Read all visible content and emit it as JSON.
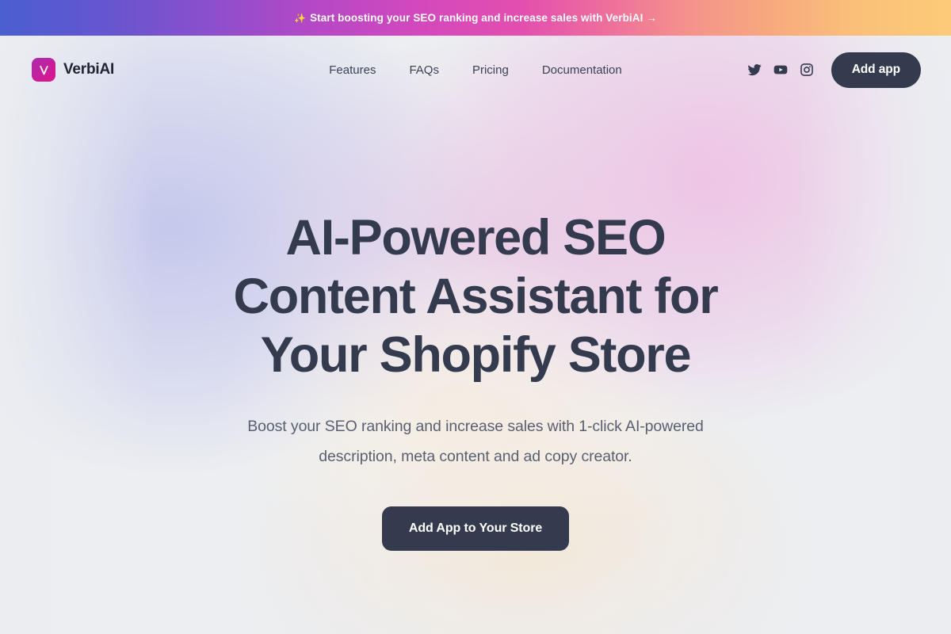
{
  "announcement": {
    "sparkle_icon": "sparkles-icon",
    "text": "Start boosting your SEO ranking and increase sales with VerbiAI →",
    "gradient_start": "#4a5fd0",
    "gradient_mid": "#d348bd",
    "gradient_end": "#fccb78"
  },
  "header": {
    "brand": {
      "name": "VerbiAI",
      "mark_icon": "verbiai-v-shield-icon",
      "mark_color_start": "#a82fae",
      "mark_color_end": "#e0148c"
    },
    "nav": [
      {
        "label": "Features"
      },
      {
        "label": "FAQs"
      },
      {
        "label": "Pricing"
      },
      {
        "label": "Documentation"
      }
    ],
    "social": [
      {
        "name": "twitter-icon",
        "label": "Twitter"
      },
      {
        "name": "youtube-icon",
        "label": "YouTube"
      },
      {
        "name": "instagram-icon",
        "label": "Instagram"
      }
    ],
    "add_app_label": "Add app",
    "button_color": "#343b4f"
  },
  "hero": {
    "title_line1": "AI-Powered SEO",
    "title_line2": "Content Assistant for",
    "title_line3": "Your Shopify Store",
    "subtitle_line1": "Boost your SEO ranking and increase sales with 1-click AI-powered",
    "subtitle_line2": "description, meta content and ad copy creator.",
    "cta_label": "Add App to Your Store",
    "title_color": "#343b4f",
    "subtitle_color": "#5a6071",
    "background_lavender": "#dcdcee",
    "background_pink": "#e6d2ec",
    "background_cream": "#f2ebe3",
    "background_base": "#eceef1"
  }
}
